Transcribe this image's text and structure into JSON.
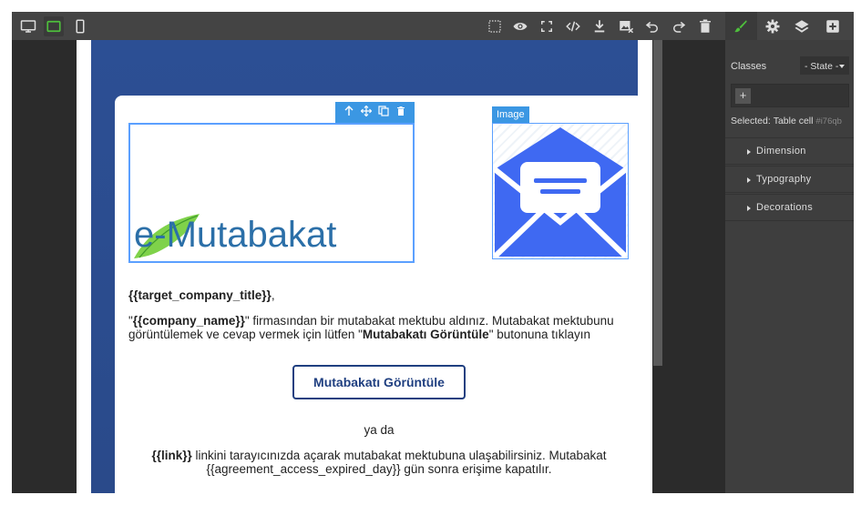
{
  "colors": {
    "toolbar_bg": "#444444",
    "canvas_bg": "#2b2b2b",
    "email_header_blue": "#2c4f94",
    "selection_blue": "#3b97e3",
    "accent_green": "#4ebf3c",
    "cta_navy": "#1f3f80",
    "envelope_blue": "#3f69f2"
  },
  "toolbar": {
    "device_icons": [
      "desktop-icon",
      "tablet-icon",
      "mobile-icon"
    ],
    "action_icons": [
      "component-outline-icon",
      "preview-eye-icon",
      "fullscreen-icon",
      "code-icon",
      "download-icon",
      "clear-image-icon",
      "undo-icon",
      "redo-icon",
      "trash-icon"
    ]
  },
  "panel_tabs": [
    "style-manager-brush-icon",
    "settings-gear-icon",
    "layers-icon",
    "blocks-plus-icon"
  ],
  "selector_manager": {
    "classes_label": "Classes",
    "state_value": "- State -",
    "add_label": "+",
    "selected_label": "Selected:",
    "selected_name": "Table cell",
    "selected_id": "#i76qb"
  },
  "sectors": [
    {
      "label": "Dimension"
    },
    {
      "label": "Typography"
    },
    {
      "label": "Decorations"
    }
  ],
  "email": {
    "logo_text": "e-Mutabakat",
    "image_badge": "Image",
    "greeting": "{{target_company_title}}",
    "greeting_suffix": ",",
    "body_quote_open": "\"",
    "company_var": "{{company_name}}",
    "body_mid": "\" firmasından bir mutabakat mektubu aldınız. Mutabakat mektubunu görüntülemek ve cevap vermek için lütfen \"",
    "button_ref": "Mutabakatı Görüntüle",
    "body_end": "\" butonuna tıklayın",
    "cta_label": "Mutabakatı Görüntüle",
    "or_text": "ya da",
    "link_var": "{{link}}",
    "link_text": " linkini tarayıcınızda açarak mutabakat mektubuna ulaşabilirsiniz. Mutabakat {{agreement_access_expired_day}} gün sonra erişime kapatılır."
  }
}
